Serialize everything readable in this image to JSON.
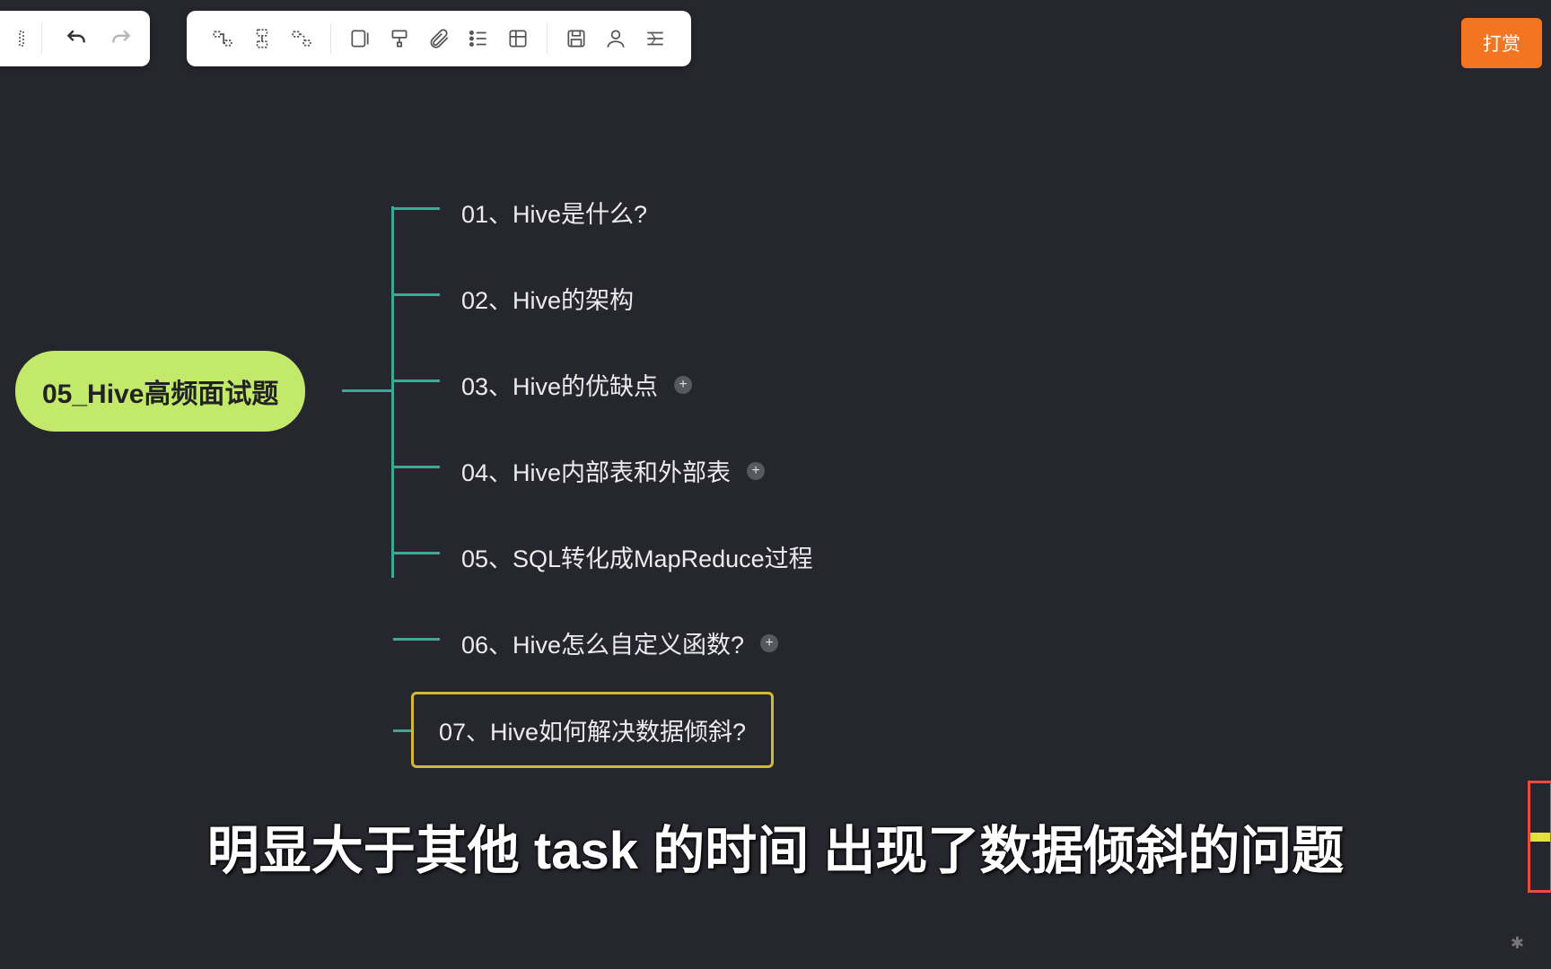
{
  "toolbar": {
    "reward_label": "打赏"
  },
  "mindmap": {
    "root": "05_Hive高频面试题",
    "children": [
      {
        "label": "01、Hive是什么?",
        "expandable": false,
        "selected": false
      },
      {
        "label": "02、Hive的架构",
        "expandable": false,
        "selected": false
      },
      {
        "label": "03、Hive的优缺点",
        "expandable": true,
        "selected": false
      },
      {
        "label": "04、Hive内部表和外部表",
        "expandable": true,
        "selected": false
      },
      {
        "label": "05、SQL转化成MapReduce过程",
        "expandable": false,
        "selected": false
      },
      {
        "label": "06、Hive怎么自定义函数?",
        "expandable": true,
        "selected": false
      },
      {
        "label": "07、Hive如何解决数据倾斜?",
        "expandable": false,
        "selected": true
      }
    ]
  },
  "subtitle": "明显大于其他 task 的时间 出现了数据倾斜的问题"
}
